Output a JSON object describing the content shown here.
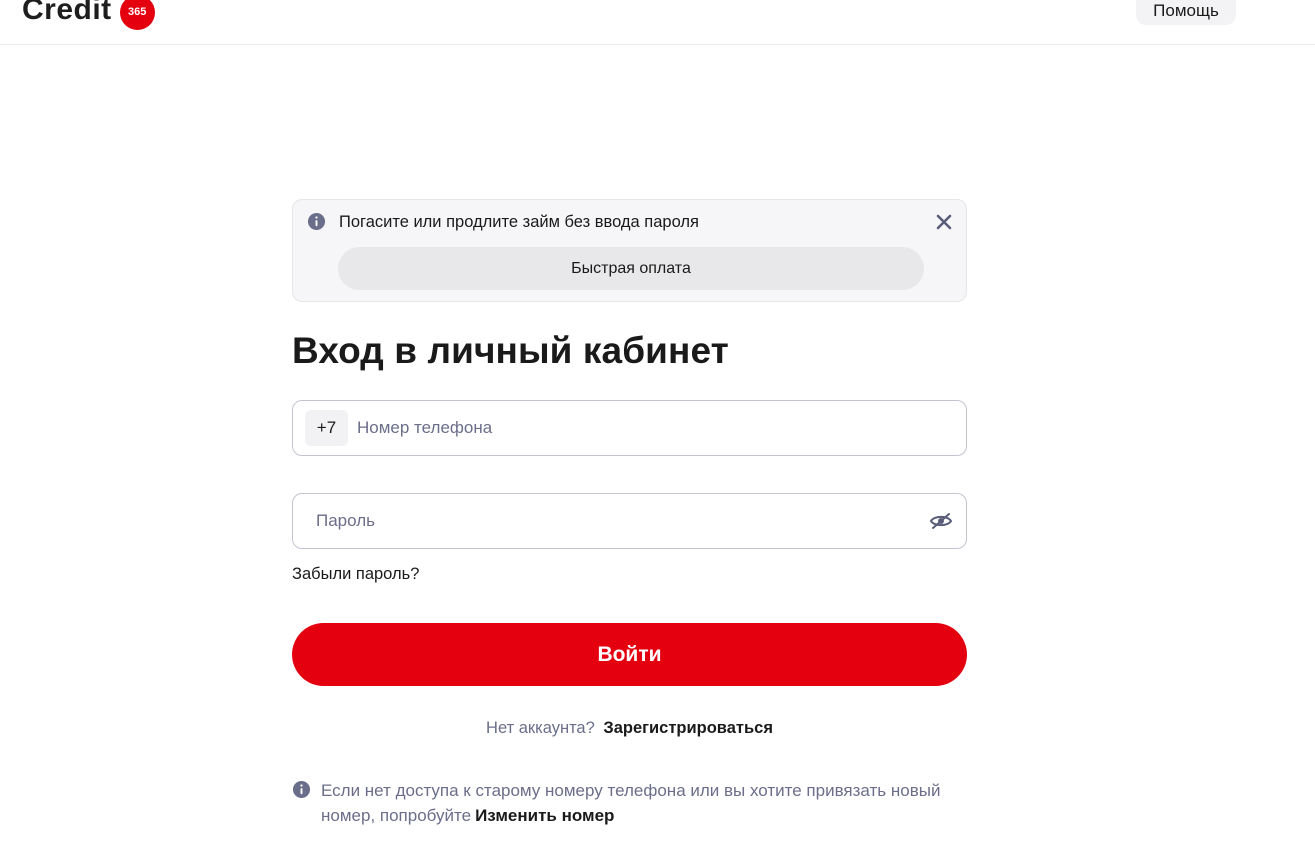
{
  "header": {
    "logo_text": "Credit",
    "logo_badge": "365",
    "help_label": "Помощь"
  },
  "banner": {
    "text": "Погасите или продлите займ без ввода пароля",
    "quick_pay_label": "Быстрая оплата",
    "icons": {
      "info": "info-icon",
      "close": "close-icon"
    }
  },
  "login": {
    "title": "Вход в личный кабинет",
    "phone_prefix": "+7",
    "phone_placeholder": "Номер телефона",
    "phone_value": "",
    "password_placeholder": "Пароль",
    "password_value": "",
    "forgot_label": "Забыли пароль?",
    "submit_label": "Войти",
    "no_account_text": "Нет аккаунта?",
    "register_label": "Зарегистрироваться",
    "icons": {
      "password_toggle": "eye-off-icon"
    }
  },
  "note": {
    "text": "Если нет доступа к старому номеру телефона или вы хотите привязать новый номер, попробуйте",
    "link_label": "Изменить номер"
  },
  "colors": {
    "accent": "#e4000f",
    "muted_text": "#6b6e8a",
    "banner_bg": "#f6f6f8"
  }
}
